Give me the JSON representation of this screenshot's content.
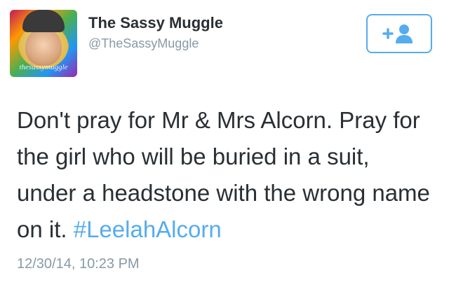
{
  "author": {
    "display_name": "The Sassy Muggle",
    "handle": "@TheSassyMuggle",
    "avatar_watermark": "thesassymuggle"
  },
  "follow_button": {
    "icon": "follow-user-icon"
  },
  "tweet": {
    "text": "Don't pray for Mr & Mrs Alcorn. Pray for the girl who will be buried in a suit, under a headstone with the wrong name on it. ",
    "hashtag": "#LeelahAlcorn"
  },
  "timestamp": "12/30/14, 10:23 PM",
  "colors": {
    "link": "#55acee",
    "text": "#292f33",
    "muted": "#8899a6"
  }
}
